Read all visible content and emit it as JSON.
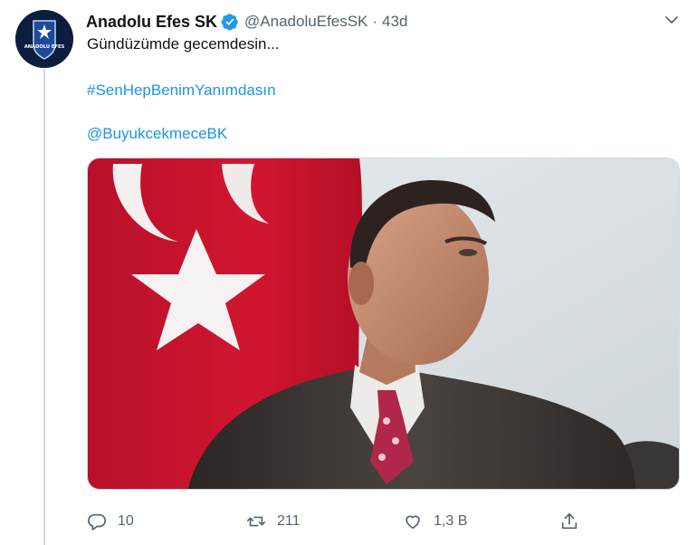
{
  "tweet": {
    "author": {
      "display_name": "Anadolu Efes SK",
      "handle": "@AnadoluEfesSK",
      "verified": true,
      "avatar_icon": "anadolu-efes-logo",
      "avatar_logo_text": "ANADOLU EFES"
    },
    "separator": "·",
    "time": "43d",
    "lines": {
      "text": "Gündüzümde gecemdesin...",
      "hashtag": "#SenHepBenimYanımdasın",
      "mention": "@BuyukcekmeceBK"
    },
    "media": {
      "description_icon": "photo"
    },
    "actions": {
      "reply": {
        "icon": "reply-icon",
        "count": "10"
      },
      "retweet": {
        "icon": "retweet-icon",
        "count": "211"
      },
      "like": {
        "icon": "heart-icon",
        "count": "1,3 B"
      },
      "share": {
        "icon": "share-icon"
      }
    }
  },
  "colors": {
    "link": "#1b95e0",
    "secondary_text": "#536471",
    "verified": "#1d9bf0",
    "flag_red": "#c8102e"
  }
}
